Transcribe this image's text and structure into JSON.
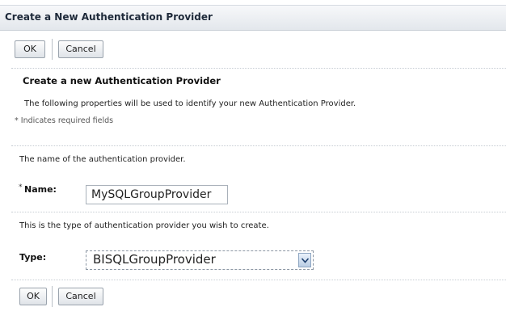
{
  "header": {
    "title": "Create a New Authentication Provider"
  },
  "actions": {
    "ok_label": "OK",
    "cancel_label": "Cancel"
  },
  "form": {
    "heading": "Create a new Authentication Provider",
    "intro": "The following properties will be used to identify your new Authentication Provider.",
    "required_note": "* Indicates required fields",
    "name_description": "The name of the authentication provider.",
    "name_label": "Name:",
    "required_marker": "*",
    "name_value": "MySQLGroupProvider",
    "type_description": "This is the type of authentication provider you wish to create.",
    "type_label": "Type:",
    "type_value": "BISQLGroupProvider"
  },
  "icons": {
    "dropdown": "chevron-down-icon"
  }
}
